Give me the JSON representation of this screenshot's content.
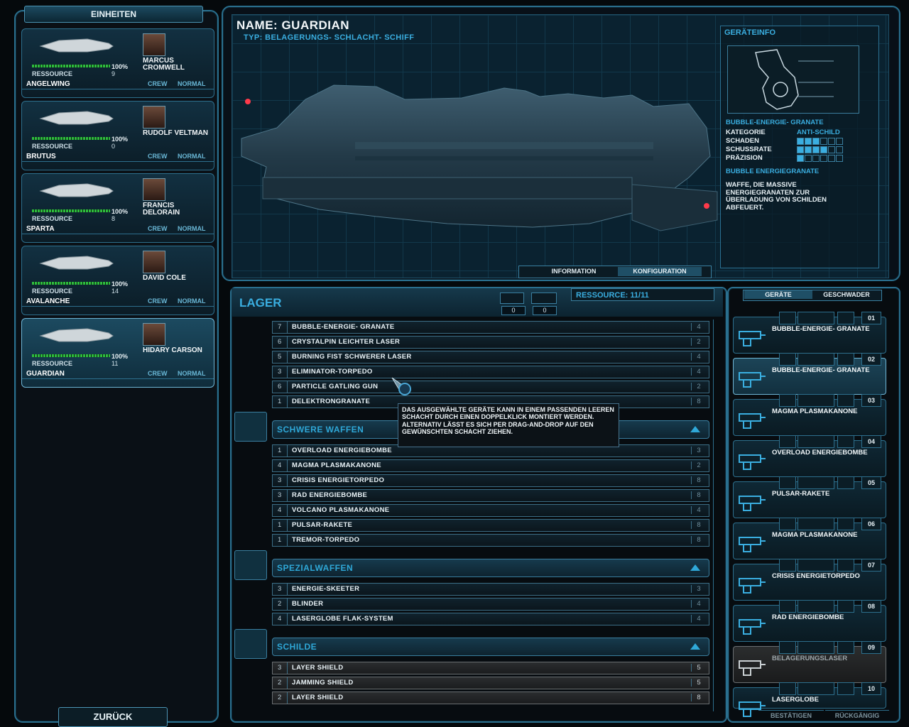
{
  "left_panel": {
    "title": "EINHEITEN",
    "units": [
      {
        "ship": "ANGELWING",
        "pilot": "MARCUS CROMWELL",
        "health": "100%",
        "resource_label": "RESSOURCE",
        "resource": "9",
        "crew": "CREW",
        "mode": "NORMAL"
      },
      {
        "ship": "BRUTUS",
        "pilot": "RUDOLF VELTMAN",
        "health": "100%",
        "resource_label": "RESSOURCE",
        "resource": "0",
        "crew": "CREW",
        "mode": "NORMAL"
      },
      {
        "ship": "SPARTA",
        "pilot": "FRANCIS DELORAIN",
        "health": "100%",
        "resource_label": "RESSOURCE",
        "resource": "8",
        "crew": "CREW",
        "mode": "NORMAL"
      },
      {
        "ship": "AVALANCHE",
        "pilot": "DAVID COLE",
        "health": "100%",
        "resource_label": "RESSOURCE",
        "resource": "14",
        "crew": "CREW",
        "mode": "NORMAL"
      },
      {
        "ship": "GUARDIAN",
        "pilot": "HIDARY CARSON",
        "health": "100%",
        "resource_label": "RESSOURCE",
        "resource": "11",
        "crew": "CREW",
        "mode": "NORMAL"
      }
    ],
    "back_button": "ZURÜCK"
  },
  "ship_view": {
    "name": "NAME: GUARDIAN",
    "type": "TYP: BELAGERUNGS- SCHLACHT- SCHIFF",
    "tabs": [
      "INFORMATION",
      "KONFIGURATION"
    ]
  },
  "device_info": {
    "title": "GERÄTEINFO",
    "item": "BUBBLE-ENERGIE- GRANATE",
    "stats": [
      {
        "label": "KATEGORIE",
        "value": "ANTI-SCHILD"
      },
      {
        "label": "SCHADEN",
        "level": 3
      },
      {
        "label": "SCHUSSRATE",
        "level": 4
      },
      {
        "label": "PRÄZISION",
        "level": 1
      }
    ],
    "subtitle": "BUBBLE ENERGIEGRANATE",
    "description": "WAFFE, DIE MASSIVE ENERGIEGRANATEN ZUR ÜBERLADUNG VON SCHILDEN ABFEUERT."
  },
  "storage": {
    "title": "LAGER",
    "resource": "RESSOURCE: 11/11",
    "counters": [
      "0",
      "0"
    ],
    "tooltip": "DAS AUSGEWÄHLTE GERÄTE KANN IN EINEM PASSENDEN LEEREN SCHACHT DURCH EINEN DOPPELKLICK MONTIERT WERDEN. ALTERNATIV LÄSST ES SICH PER DRAG-AND-DROP AUF DEN GEWÜNSCHTEN SCHACHT ZIEHEN.",
    "items_top": [
      {
        "qty": "7",
        "name": "BUBBLE-ENERGIE- GRANATE",
        "val": "4"
      },
      {
        "qty": "6",
        "name": "CRYSTALPIN LEICHTER LASER",
        "val": "2"
      },
      {
        "qty": "5",
        "name": "BURNING FIST SCHWERER LASER",
        "val": "4"
      },
      {
        "qty": "3",
        "name": "ELIMINATOR-TORPEDO",
        "val": "4"
      },
      {
        "qty": "6",
        "name": "PARTICLE GATLING GUN",
        "val": "2"
      },
      {
        "qty": "1",
        "name": "DELEKTRONGRANATE",
        "val": "8"
      }
    ],
    "categories": [
      {
        "title": "SCHWERE WAFFEN",
        "items": [
          {
            "qty": "1",
            "name": "OVERLOAD ENERGIEBOMBE",
            "val": "3"
          },
          {
            "qty": "4",
            "name": "MAGMA PLASMAKANONE",
            "val": "2"
          },
          {
            "qty": "3",
            "name": "CRISIS ENERGIETORPEDO",
            "val": "8"
          },
          {
            "qty": "3",
            "name": "RAD ENERGIEBOMBE",
            "val": "8"
          },
          {
            "qty": "4",
            "name": "VOLCANO PLASMAKANONE",
            "val": "4"
          },
          {
            "qty": "1",
            "name": "PULSAR-RAKETE",
            "val": "8"
          },
          {
            "qty": "1",
            "name": "TREMOR-TORPEDO",
            "val": "8"
          }
        ]
      },
      {
        "title": "SPEZIALWAFFEN",
        "items": [
          {
            "qty": "3",
            "name": "ENERGIE-SKEETER",
            "val": "3"
          },
          {
            "qty": "2",
            "name": "BLINDER",
            "val": "4"
          },
          {
            "qty": "4",
            "name": "LASERGLOBE FLAK-SYSTEM",
            "val": "4"
          }
        ]
      },
      {
        "title": "SCHILDE",
        "items": [
          {
            "qty": "3",
            "name": "LAYER SHIELD",
            "val": "5"
          },
          {
            "qty": "2",
            "name": "JAMMING SHIELD",
            "val": "5"
          },
          {
            "qty": "2",
            "name": "LAYER SHIELD",
            "val": "8"
          }
        ]
      }
    ]
  },
  "slots_panel": {
    "tabs": [
      "GERÄTE",
      "GESCHWADER"
    ],
    "slots": [
      {
        "num": "01",
        "label": "BUBBLE-ENERGIE- GRANATE"
      },
      {
        "num": "02",
        "label": "BUBBLE-ENERGIE- GRANATE"
      },
      {
        "num": "03",
        "label": "MAGMA PLASMAKANONE"
      },
      {
        "num": "04",
        "label": "OVERLOAD ENERGIEBOMBE"
      },
      {
        "num": "05",
        "label": "PULSAR-RAKETE"
      },
      {
        "num": "06",
        "label": "MAGMA PLASMAKANONE"
      },
      {
        "num": "07",
        "label": "CRISIS ENERGIETORPEDO"
      },
      {
        "num": "08",
        "label": "RAD ENERGIEBOMBE"
      },
      {
        "num": "09",
        "label": "BELAGERUNGSLASER"
      },
      {
        "num": "10",
        "label": "LASERGLOBE"
      }
    ],
    "confirm": "BESTÄTIGEN",
    "undo": "RÜCKGÄNGIG"
  },
  "colors": {
    "accent": "#2fa8d8",
    "frame": "#2a6f8e",
    "health": "#2ebd3e"
  }
}
